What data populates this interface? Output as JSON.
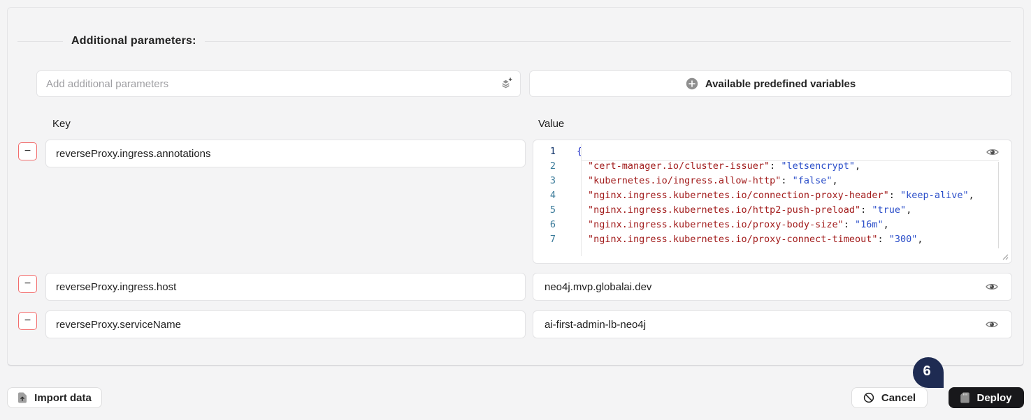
{
  "section": {
    "title": "Additional parameters:"
  },
  "controls": {
    "add_placeholder": "Add additional parameters",
    "predefined_label": "Available predefined variables"
  },
  "table": {
    "key_header": "Key",
    "value_header": "Value",
    "remove_label": "−",
    "rows": [
      {
        "key": "reverseProxy.ingress.annotations",
        "value_type": "code"
      },
      {
        "key": "reverseProxy.ingress.host",
        "value": "neo4j.mvp.globalai.dev"
      },
      {
        "key": "reverseProxy.serviceName",
        "value": "ai-first-admin-lb-neo4j"
      }
    ]
  },
  "code_editor": {
    "language": "json",
    "lines": [
      {
        "num": "1",
        "open": "{"
      },
      {
        "num": "2",
        "key": "\"cert-manager.io/cluster-issuer\"",
        "sep": ": ",
        "value": "\"letsencrypt\"",
        "end": ","
      },
      {
        "num": "3",
        "key": "\"kubernetes.io/ingress.allow-http\"",
        "sep": ": ",
        "value": "\"false\"",
        "end": ","
      },
      {
        "num": "4",
        "key": "\"nginx.ingress.kubernetes.io/connection-proxy-header\"",
        "sep": ": ",
        "value": "\"keep-alive\"",
        "end": ","
      },
      {
        "num": "5",
        "key": "\"nginx.ingress.kubernetes.io/http2-push-preload\"",
        "sep": ": ",
        "value": "\"true\"",
        "end": ","
      },
      {
        "num": "6",
        "key": "\"nginx.ingress.kubernetes.io/proxy-body-size\"",
        "sep": ": ",
        "value": "\"16m\"",
        "end": ","
      },
      {
        "num": "7",
        "key": "\"nginx.ingress.kubernetes.io/proxy-connect-timeout\"",
        "sep": ": ",
        "value": "\"300\"",
        "end": ","
      }
    ]
  },
  "footer": {
    "import_label": "Import data",
    "cancel_label": "Cancel",
    "deploy_label": "Deploy"
  },
  "annotation": {
    "step": "6"
  },
  "colors": {
    "page_background": "#f4f4f5",
    "remove_button_border": "#f26d6d",
    "deploy_button_bg": "#18181b",
    "annotation_pin": "#1e2b52",
    "code_key": "#a21c1c",
    "code_value": "#2b4ec9",
    "code_brace": "#1b2bc8",
    "line_numbers": "#3a7a99"
  }
}
